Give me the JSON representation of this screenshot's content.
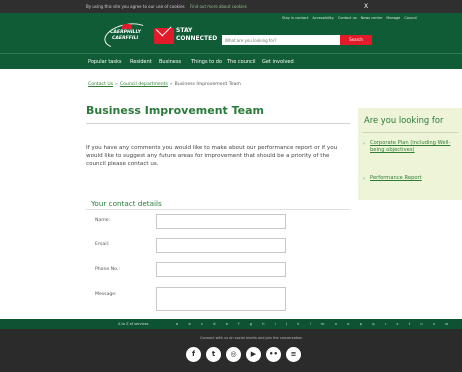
{
  "cookie_bar": {
    "text": "By using this site you agree to our use of cookies",
    "more_link": "Find out more about cookies",
    "close_label": "X"
  },
  "header": {
    "util_links": [
      "Stay in contact",
      "Accessibility",
      "Contact us",
      "News centre",
      "Manage",
      "Council"
    ],
    "logo_line1": "CAERPHILLY",
    "logo_line2": "CAERFFILI",
    "stay_line1": "STAY",
    "stay_line2": "CONNECTED",
    "search_placeholder": "What are you looking for?",
    "search_button": "Search"
  },
  "nav": {
    "items": [
      "Popular tasks",
      "Resident",
      "Business",
      "Things to do",
      "The council",
      "Get involved"
    ]
  },
  "breadcrumb": {
    "items": [
      "Contact Us",
      "Council departments",
      "Business Improvement Team"
    ]
  },
  "main": {
    "title": "Business Improvement Team",
    "intro": "If you have any comments you would like to make about our performance report or if you would like to suggest any future areas for improvement that should be a priority of the council please contact us."
  },
  "sidebar": {
    "heading": "Are you looking for",
    "links": [
      "Corporate Plan (including Well-being objectives)",
      "Performance Report"
    ]
  },
  "form": {
    "heading": "Your contact details",
    "fields": [
      {
        "label": "Name:",
        "value": ""
      },
      {
        "label": "Email:",
        "value": ""
      },
      {
        "label": "Phone No.:",
        "value": ""
      },
      {
        "label": "Message:",
        "value": ""
      }
    ]
  },
  "alpha_bar": {
    "label": "A to Z of services",
    "letters": "a b c d e f g h i j k l m n o p q r s t u v w x y z"
  },
  "footer": {
    "text": "Connect with us on social media and join the conversation",
    "social": [
      {
        "icon": "facebook-icon",
        "glyph": "f"
      },
      {
        "icon": "twitter-icon",
        "glyph": "t"
      },
      {
        "icon": "instagram-icon",
        "glyph": "◎"
      },
      {
        "icon": "youtube-icon",
        "glyph": "▶"
      },
      {
        "icon": "flickr-icon",
        "glyph": "••"
      },
      {
        "icon": "rss-icon",
        "glyph": "≡"
      }
    ]
  },
  "colors": {
    "brand_green": "#0f5c36",
    "accent_red": "#e21b2a",
    "link_green": "#2e7d32",
    "sidebar_bg": "#eef4d8"
  }
}
